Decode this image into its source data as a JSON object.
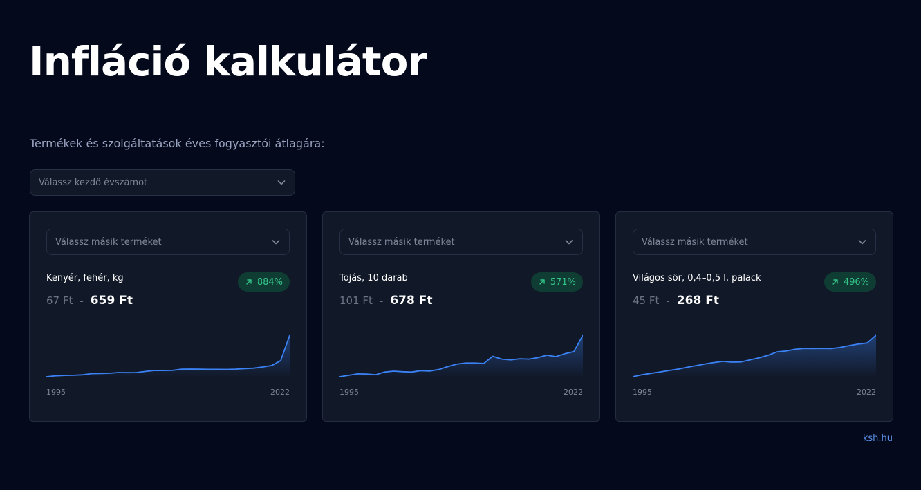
{
  "title": "Infláció kalkulátor",
  "subtitle": "Termékek és szolgáltatások éves fogyasztói átlagára:",
  "year_select": {
    "placeholder": "Válassz kezdő évszámot"
  },
  "colors": {
    "accent": "#3b82f6",
    "badge_bg": "#0f3d33",
    "badge_text": "#34c48a",
    "background": "#040a1c",
    "card": "#111827"
  },
  "cards": [
    {
      "select_placeholder": "Válassz másik terméket",
      "name": "Kenyér, fehér, kg",
      "badge": "884%",
      "price_old": "67 Ft",
      "separator": "-",
      "price_new": "659 Ft",
      "year_start": "1995",
      "year_end": "2022",
      "series": [
        67,
        80,
        86,
        88,
        94,
        110,
        113,
        116,
        126,
        124,
        126,
        142,
        156,
        155,
        157,
        174,
        176,
        174,
        172,
        172,
        171,
        175,
        182,
        188,
        205,
        226,
        297,
        659
      ]
    },
    {
      "select_placeholder": "Válassz másik terméket",
      "name": "Tojás, 10 darab",
      "badge": "571%",
      "price_old": "101 Ft",
      "separator": "-",
      "price_new": "678 Ft",
      "year_start": "1995",
      "year_end": "2022",
      "series": [
        101,
        120,
        140,
        138,
        128,
        165,
        178,
        170,
        165,
        185,
        180,
        200,
        240,
        275,
        290,
        290,
        285,
        385,
        345,
        335,
        350,
        345,
        365,
        400,
        380,
        420,
        450,
        678
      ]
    },
    {
      "select_placeholder": "Válassz másik terméket",
      "name": "Világos sör, 0,4–0,5 l, palack",
      "badge": "496%",
      "price_old": "45 Ft",
      "separator": "-",
      "price_new": "268 Ft",
      "year_start": "1995",
      "year_end": "2022",
      "series": [
        45,
        55,
        63,
        70,
        78,
        85,
        95,
        104,
        113,
        121,
        127,
        123,
        124,
        135,
        146,
        160,
        178,
        183,
        192,
        197,
        196,
        197,
        196,
        202,
        212,
        220,
        226,
        268
      ]
    }
  ],
  "source_link": "ksh.hu"
}
